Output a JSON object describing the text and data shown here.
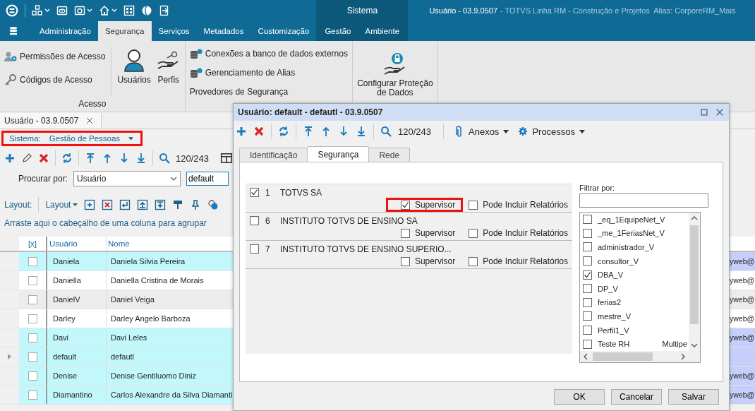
{
  "title_bar": {
    "context_label": "Sistema",
    "title": "Usuário - 03.9.0507",
    "subtitle": "- TOTVS Linha RM - Construção e Projetos  Alias: CorporeRM_Mais"
  },
  "menu_tabs": [
    {
      "label": "Administração",
      "selected": false,
      "contextual": false
    },
    {
      "label": "Segurança",
      "selected": true,
      "contextual": false
    },
    {
      "label": "Serviços",
      "selected": false,
      "contextual": false
    },
    {
      "label": "Metadados",
      "selected": false,
      "contextual": false
    },
    {
      "label": "Customização",
      "selected": false,
      "contextual": false
    },
    {
      "label": "Gestão",
      "selected": false,
      "contextual": true
    },
    {
      "label": "Ambiente",
      "selected": false,
      "contextual": true
    }
  ],
  "ribbon": {
    "groups": [
      {
        "label": "Acesso",
        "small_items": [
          "Permissões de Acesso",
          "Códigos de Acesso"
        ],
        "large_items": [
          "Usuários",
          "Perfis"
        ]
      },
      {
        "small_items": [
          "Conexões a banco de dados externos",
          "Gerenciamento de Alias",
          "Provedores de Segurança"
        ]
      },
      {
        "large_items": [
          "Configurar Proteção de Dados"
        ]
      }
    ]
  },
  "document_tab": {
    "label": "Usuário - 03.9.0507"
  },
  "system_filter": {
    "label": "Sistema:",
    "value": "Gestão de Pessoas",
    "highlighted": true
  },
  "toolbar": {
    "record_counter": "120/243"
  },
  "search": {
    "label": "Procurar por:",
    "field": "Usuário",
    "value": "default"
  },
  "layout_bar": {
    "label": "Layout:",
    "menu": "Layout"
  },
  "group_hint": "Arraste aqui o cabeçalho de uma coluna para agrupar",
  "grid": {
    "columns": [
      "[x]",
      "Usuário",
      "Nome"
    ],
    "rows": [
      {
        "checked": false,
        "usuario": "Daniela",
        "nome": "Daniela Silvia Pereira",
        "column_4": "yweb@",
        "selected": true,
        "current": false
      },
      {
        "checked": false,
        "usuario": "Daniella",
        "nome": "Daniella Cristina de Morais",
        "column_4": "yweb@",
        "selected": false,
        "current": false
      },
      {
        "checked": false,
        "usuario": "DanielV",
        "nome": "Daniel Veiga",
        "column_4": "yweb@",
        "selected": false,
        "current": false
      },
      {
        "checked": false,
        "usuario": "Darley",
        "nome": "Darley Angelo Barboza",
        "column_4": "yweb@",
        "selected": false,
        "current": false
      },
      {
        "checked": false,
        "usuario": "Davi",
        "nome": "Davi Leles",
        "column_4": "yweb@",
        "selected": true,
        "current": false
      },
      {
        "checked": false,
        "usuario": "default",
        "nome": "defautl",
        "selected": true,
        "current": true
      },
      {
        "checked": false,
        "usuario": "Denise",
        "nome": "Denise Gentiluomo Diniz",
        "column_4": "yweb@",
        "selected": true,
        "current": false
      },
      {
        "checked": false,
        "usuario": "Diamantino",
        "nome": "Carlos Alexandre da Silva Diamanti",
        "column_4": "yweb@",
        "selected": true,
        "current": false
      }
    ]
  },
  "dialog": {
    "title": "Usuário: default - defautl - 03.9.0507",
    "record_counter": "120/243",
    "attachments": "Anexos",
    "processes": "Processos",
    "tabs": [
      {
        "label": "Identificação",
        "selected": false
      },
      {
        "label": "Segurança",
        "selected": true
      },
      {
        "label": "Rede",
        "selected": false
      }
    ],
    "companies": [
      {
        "checked": true,
        "code": "1",
        "name": "TOTVS SA",
        "supervisor": true,
        "supervisor_label": "Supervisor",
        "reports": false,
        "reports_label": "Pode Incluir Relatórios",
        "highlighted": true
      },
      {
        "checked": false,
        "code": "6",
        "name": "INSTITUTO TOTVS DE ENSINO SA",
        "supervisor": false,
        "supervisor_label": "Supervisor",
        "reports": false,
        "reports_label": "Pode Incluir Relatórios",
        "highlighted": false
      },
      {
        "checked": false,
        "code": "7",
        "name": "INSTITUTO TOTVS DE ENSINO SUPERIO...",
        "supervisor": false,
        "supervisor_label": "Supervisor",
        "reports": false,
        "reports_label": "Pode Incluir Relatórios",
        "highlighted": false
      }
    ],
    "filter_label": "Filtrar por:",
    "profiles": [
      {
        "label": "_eq_1EquipeNet_V",
        "checked": false
      },
      {
        "label": "_me_1FeriasNet_V",
        "checked": false
      },
      {
        "label": "administrador_V",
        "checked": false
      },
      {
        "label": "consultor_V",
        "checked": false
      },
      {
        "label": "DBA_V",
        "checked": true
      },
      {
        "label": "DP_V",
        "checked": false
      },
      {
        "label": "ferias2",
        "checked": false
      },
      {
        "label": "mestre_V",
        "checked": false
      },
      {
        "label": "Perfil1_V",
        "checked": false
      },
      {
        "label": "Teste RH",
        "checked": false,
        "note": "Multipe"
      }
    ],
    "buttons": [
      "OK",
      "Cancelar",
      "Salvar"
    ]
  }
}
